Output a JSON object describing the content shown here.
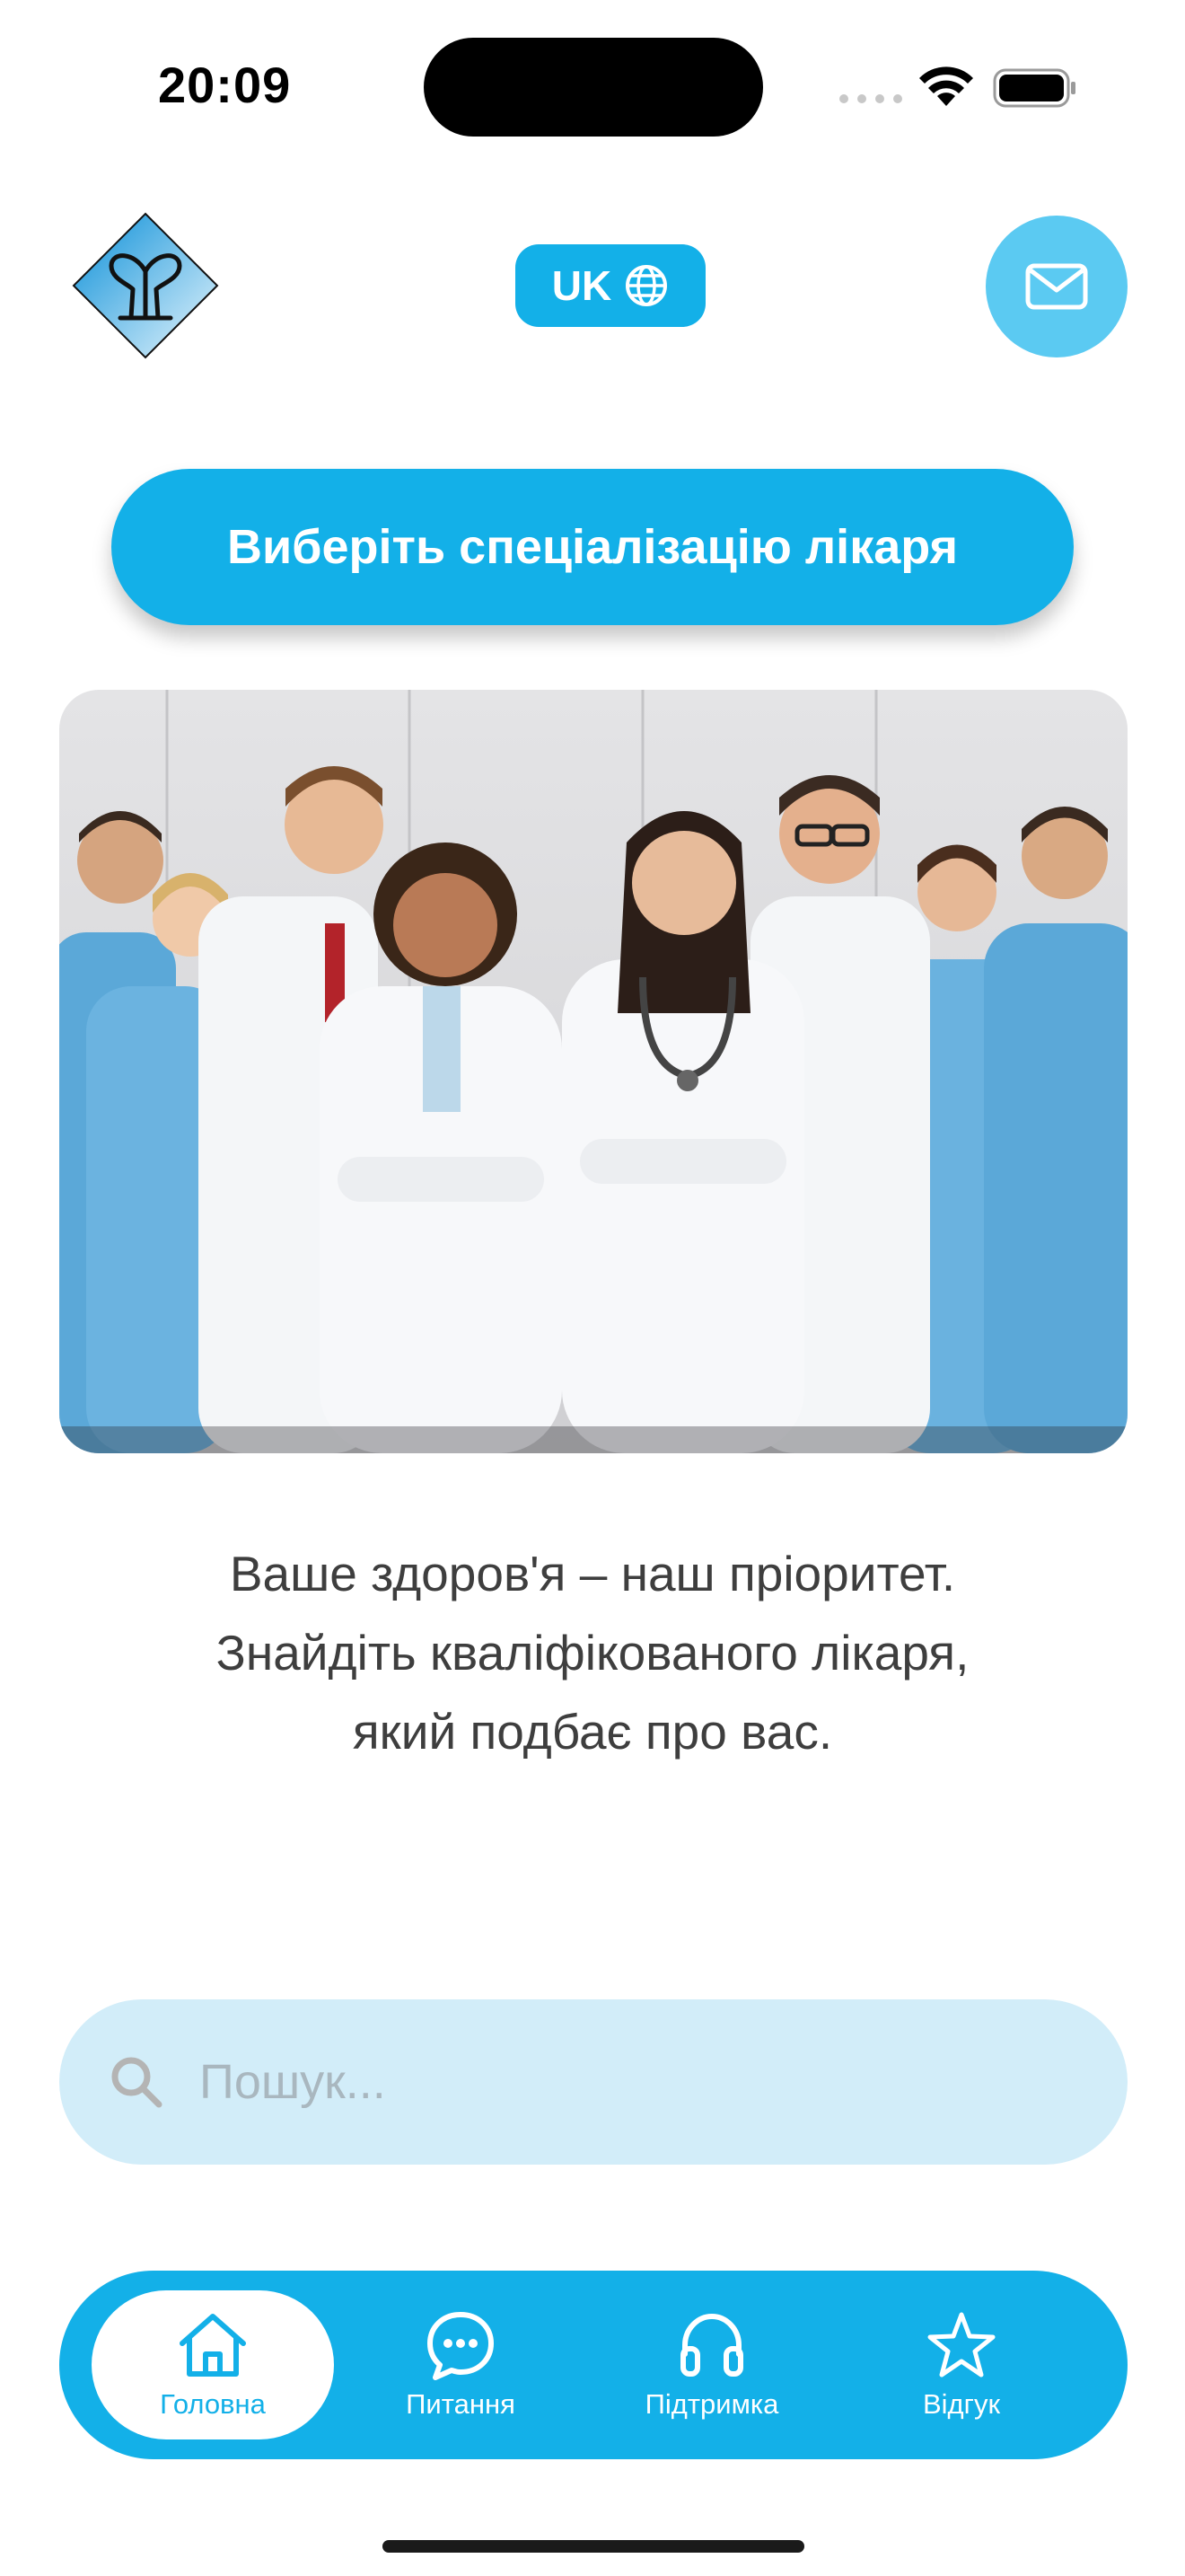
{
  "status_bar": {
    "time": "20:09"
  },
  "header": {
    "logo_icon": "medical-monogram-logo",
    "language_label": "UK",
    "language_icon": "globe-icon",
    "mail_icon": "envelope-icon"
  },
  "cta": {
    "label": "Виберіть спеціалізацію лікаря"
  },
  "hero": {
    "description_icon": "doctors-team-photo"
  },
  "tagline": {
    "line1": "Ваше здоров'я – наш пріоритет.",
    "line2": "Знайдіть кваліфікованого лікаря,",
    "line3": "який подбає про вас."
  },
  "search": {
    "placeholder": "Пошук..."
  },
  "tabbar": {
    "items": [
      {
        "label": "Головна",
        "icon": "home-icon",
        "active": true
      },
      {
        "label": "Питання",
        "icon": "chat-bubble-icon",
        "active": false
      },
      {
        "label": "Підтримка",
        "icon": "headphones-icon",
        "active": false
      },
      {
        "label": "Відгук",
        "icon": "star-icon",
        "active": false
      }
    ]
  },
  "colors": {
    "accent": "#13b0e8",
    "accent_light": "#5bcaf2",
    "search_bg": "#d2edf9",
    "text_dark": "#3e3e3e"
  }
}
